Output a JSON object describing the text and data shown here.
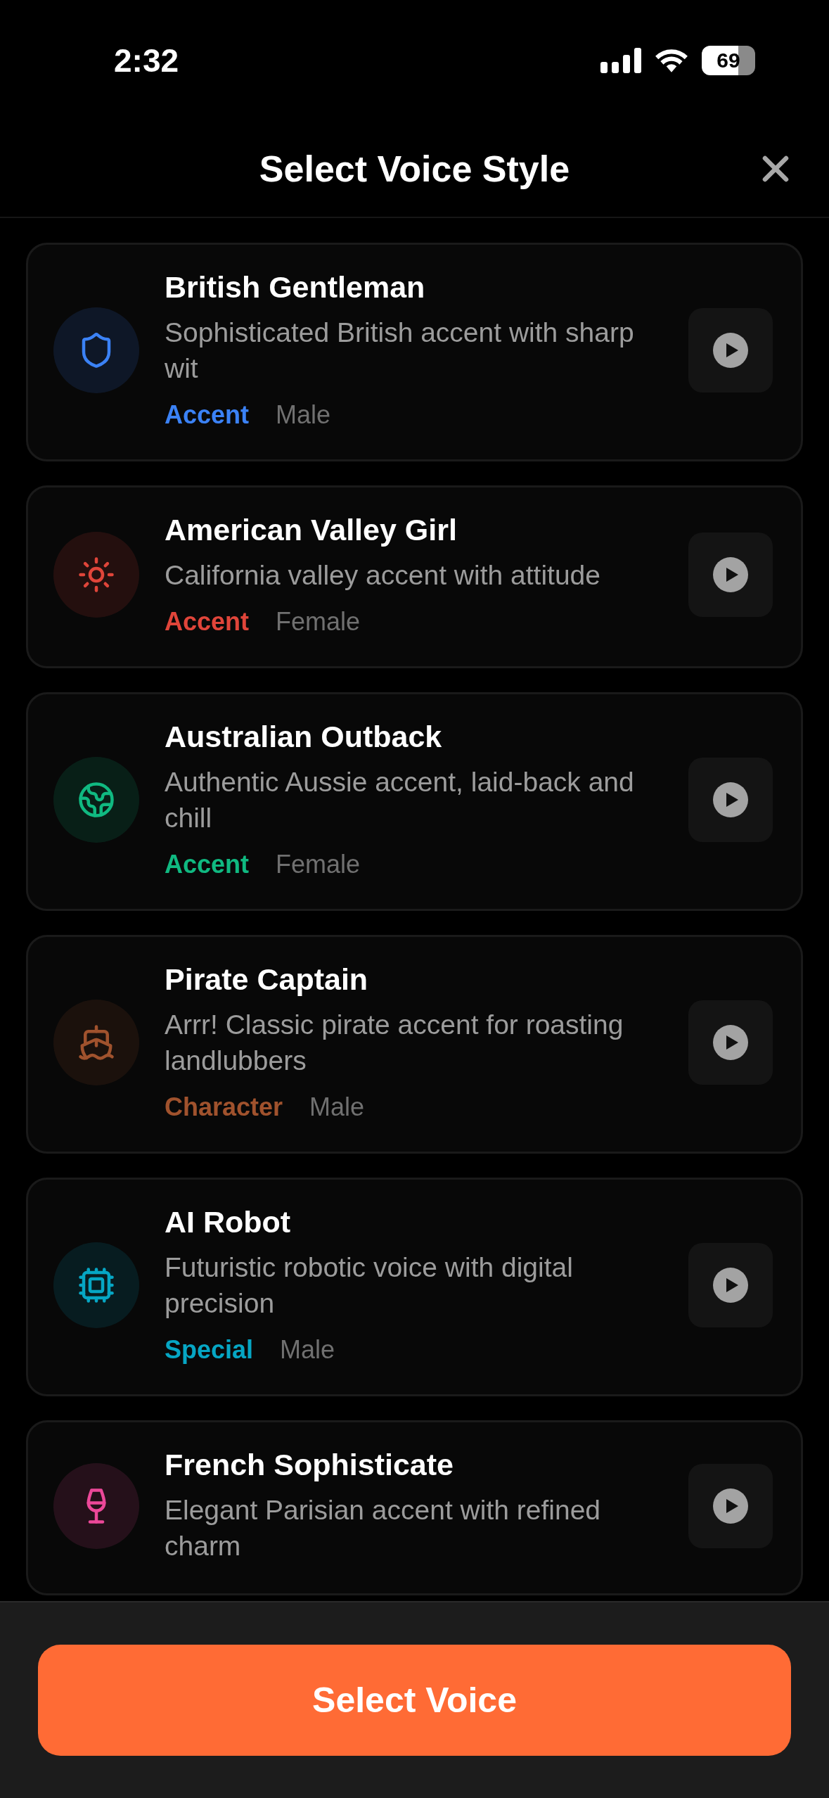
{
  "status_bar": {
    "time": "2:32",
    "battery": "69"
  },
  "header": {
    "title": "Select Voice Style"
  },
  "voices": [
    {
      "name": "British Gentleman",
      "description": "Sophisticated British accent with sharp wit",
      "category": "Accent",
      "gender": "Male",
      "color": "#3b82f6"
    },
    {
      "name": "American Valley Girl",
      "description": "California valley accent with attitude",
      "category": "Accent",
      "gender": "Female",
      "color": "#e0453a"
    },
    {
      "name": "Australian Outback",
      "description": "Authentic Aussie accent, laid-back and chill",
      "category": "Accent",
      "gender": "Female",
      "color": "#10b981"
    },
    {
      "name": "Pirate Captain",
      "description": "Arrr! Classic pirate accent for roasting landlubbers",
      "category": "Character",
      "gender": "Male",
      "color": "#a0522d"
    },
    {
      "name": "AI Robot",
      "description": "Futuristic robotic voice with digital precision",
      "category": "Special",
      "gender": "Male",
      "color": "#06a6c4"
    },
    {
      "name": "French Sophisticate",
      "description": "Elegant Parisian accent with refined charm",
      "color": "#ec4899"
    }
  ],
  "footer": {
    "button": "Select Voice"
  }
}
